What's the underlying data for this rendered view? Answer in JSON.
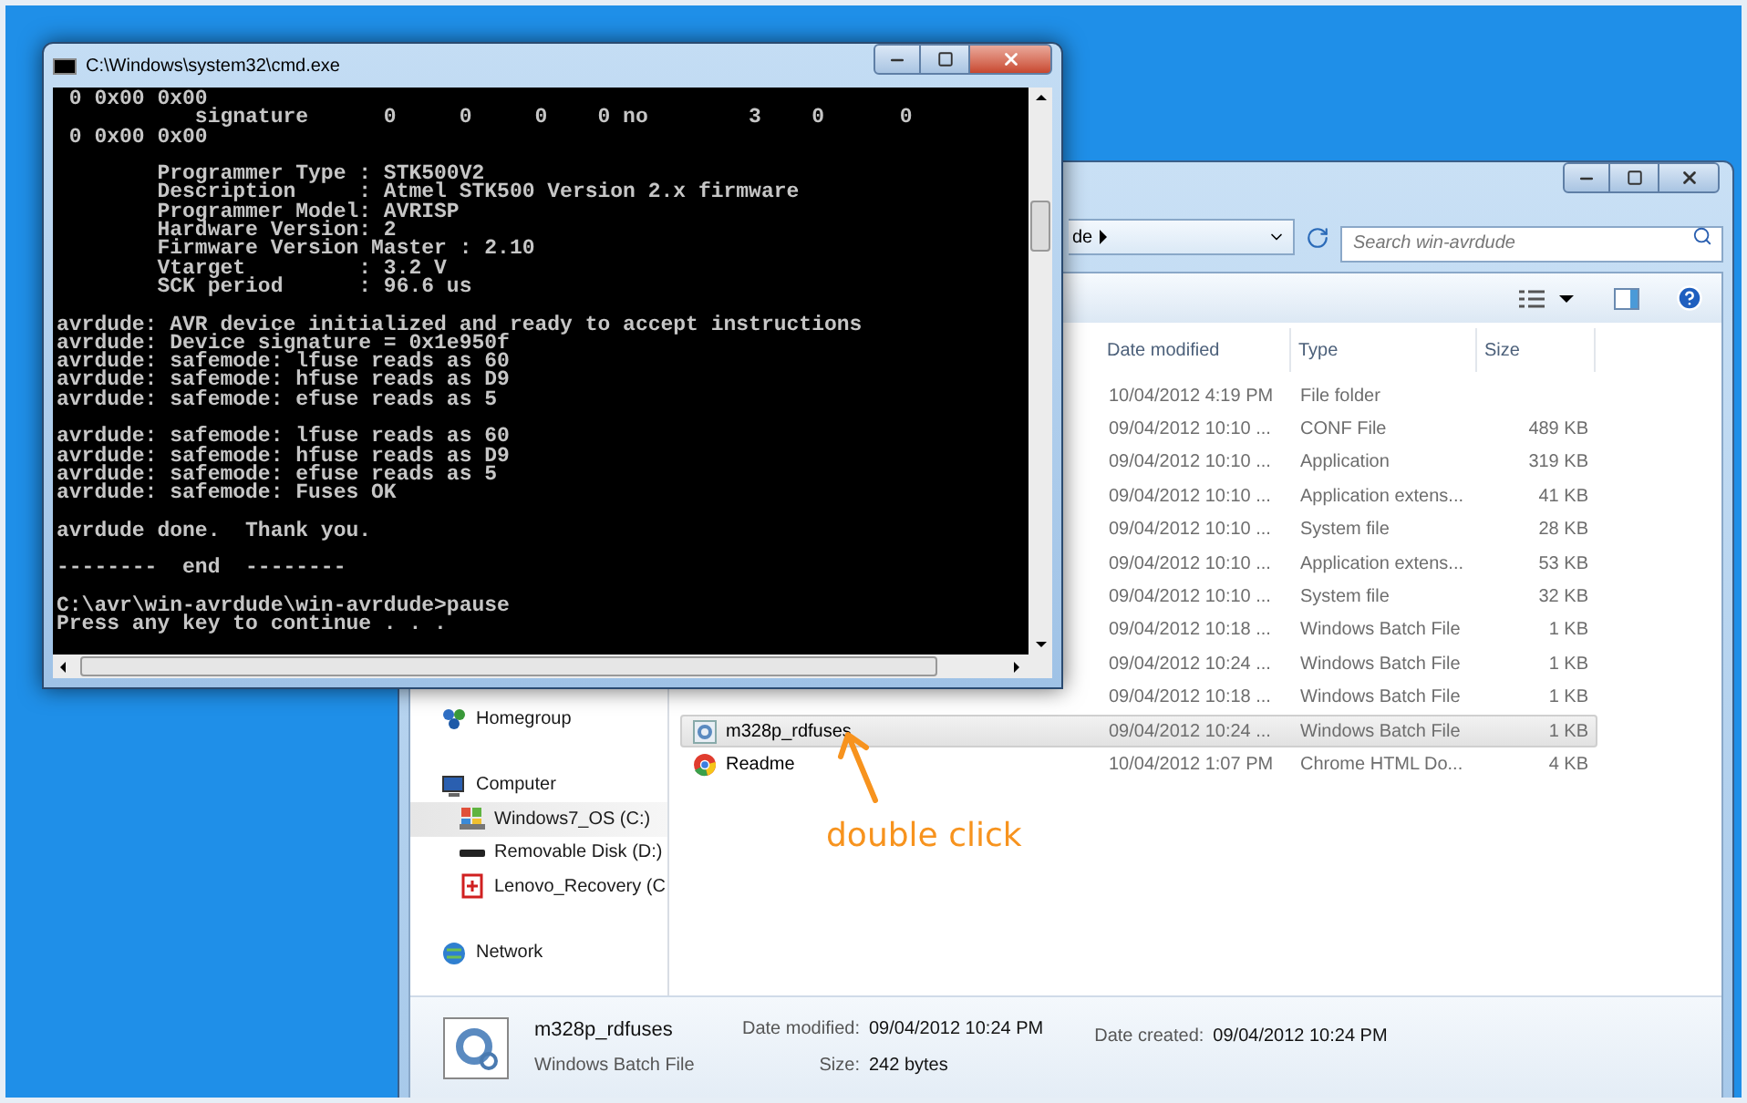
{
  "explorer": {
    "address": {
      "text": "de"
    },
    "search": {
      "placeholder": "Search win-avrdude"
    },
    "columns": [
      "Date modified",
      "Type",
      "Size"
    ],
    "files": [
      {
        "date": "10/04/2012 4:19 PM",
        "type": "File folder",
        "selected": false
      },
      {
        "date": "09/04/2012 10:10 ...",
        "type": "CONF File",
        "size": "489 KB",
        "selected": false
      },
      {
        "date": "09/04/2012 10:10 ...",
        "type": "Application",
        "size": "319 KB",
        "selected": false
      },
      {
        "date": "09/04/2012 10:10 ...",
        "type": "Application extens...",
        "size": "41 KB",
        "selected": false
      },
      {
        "date": "09/04/2012 10:10 ...",
        "type": "System file",
        "size": "28 KB",
        "selected": false
      },
      {
        "date": "09/04/2012 10:10 ...",
        "type": "Application extens...",
        "size": "53 KB",
        "selected": false
      },
      {
        "date": "09/04/2012 10:10 ...",
        "type": "System file",
        "size": "32 KB",
        "selected": false
      },
      {
        "date": "09/04/2012 10:18 ...",
        "type": "Windows Batch File",
        "size": "1 KB",
        "selected": false
      },
      {
        "date": "09/04/2012 10:24 ...",
        "type": "Windows Batch File",
        "size": "1 KB",
        "selected": false
      },
      {
        "date": "09/04/2012 10:18 ...",
        "type": "Windows Batch File",
        "size": "1 KB",
        "selected": false
      },
      {
        "name": "m328p_rdfuses",
        "kind": "batch",
        "date": "09/04/2012 10:24 ...",
        "type": "Windows Batch File",
        "size": "1 KB",
        "selected": true
      },
      {
        "name": "Readme",
        "kind": "chrome",
        "date": "10/04/2012 1:07 PM",
        "type": "Chrome HTML Do...",
        "size": "4 KB",
        "selected": false
      }
    ],
    "nav": [
      {
        "label": "Homegroup",
        "kind": "homegroup",
        "selected": false
      },
      {
        "label": "Computer",
        "kind": "computer",
        "selected": false,
        "children": [
          {
            "label": "Windows7_OS (C:)",
            "kind": "drive",
            "selected": true
          },
          {
            "label": "Removable Disk (D:)",
            "kind": "removable",
            "selected": false
          },
          {
            "label": "Lenovo_Recovery (C",
            "kind": "recovery",
            "selected": false
          }
        ]
      },
      {
        "label": "Network",
        "kind": "network",
        "selected": false
      }
    ],
    "details": {
      "name": "m328p_rdfuses",
      "type": "Windows Batch File",
      "fields": [
        {
          "label": "Date modified:",
          "value": "09/04/2012 10:24 PM"
        },
        {
          "label": "Size:",
          "value": "242 bytes"
        },
        {
          "label": "Date created:",
          "value": "09/04/2012 10:24 PM"
        }
      ]
    }
  },
  "cmd": {
    "title": "C:\\Windows\\system32\\cmd.exe",
    "blocks": [
      [
        " 0 0x00 0x00",
        "           signature      0     0     0    0 no        3    0      0",
        " 0 0x00 0x00"
      ],
      [
        "        Programmer Type : STK500V2",
        "        Description     : Atmel STK500 Version 2.x firmware",
        "        Programmer Model: AVRISP",
        "        Hardware Version: 2",
        "        Firmware Version Master : 2.10",
        "        Vtarget         : 3.2 V",
        "        SCK period      : 96.6 us"
      ],
      [
        "avrdude: AVR device initialized and ready to accept instructions",
        "avrdude: Device signature = 0x1e950f",
        "avrdude: safemode: lfuse reads as 60",
        "avrdude: safemode: hfuse reads as D9",
        "avrdude: safemode: efuse reads as 5"
      ],
      [
        "avrdude: safemode: lfuse reads as 60",
        "avrdude: safemode: hfuse reads as D9",
        "avrdude: safemode: efuse reads as 5",
        "avrdude: safemode: Fuses OK"
      ],
      [
        "avrdude done.  Thank you."
      ],
      [
        "--------  end  --------"
      ],
      [
        "C:\\avr\\win-avrdude\\win-avrdude>pause",
        "Press any key to continue . . ."
      ]
    ]
  },
  "annotation": {
    "text": "double click"
  }
}
